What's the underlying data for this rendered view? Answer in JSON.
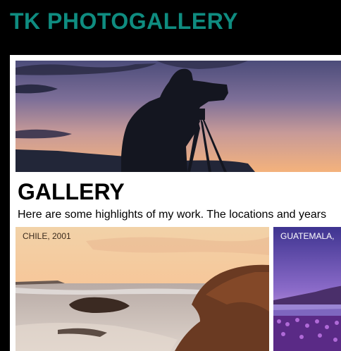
{
  "header": {
    "title": "TK PHOTOGALLERY",
    "title_color": "#0f8c80",
    "background": "#000000"
  },
  "hero": {
    "image": "photographer-silhouette-at-sunset"
  },
  "gallery": {
    "heading": "GALLERY",
    "intro": "Here are some highlights of my work. The locations and years"
  },
  "photos": [
    {
      "caption": "CHILE, 2001",
      "image": "rocky-beach-at-sunset"
    },
    {
      "caption": "GUATEMALA,",
      "image": "purple-flowers-by-lake"
    }
  ]
}
